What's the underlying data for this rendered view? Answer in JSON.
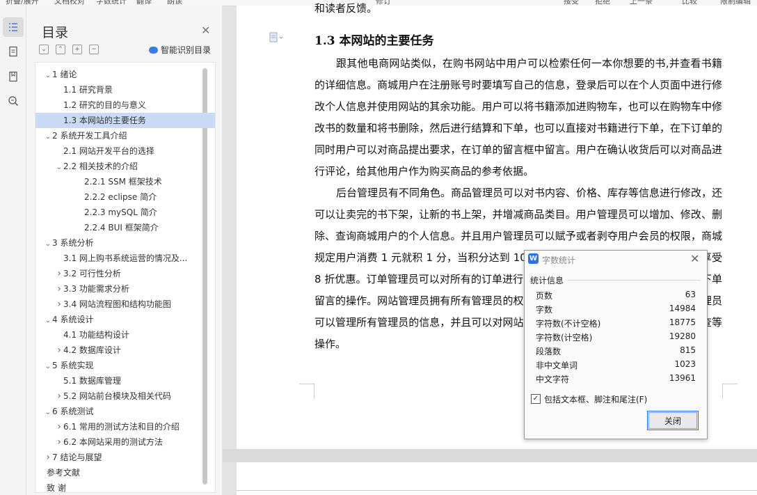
{
  "toolbar": {
    "items": [
      "折叠/展开",
      "文档校对",
      "字数统计",
      "翻译",
      "朗读",
      "修订",
      "接受",
      "拒绝",
      "上一条",
      "下一条",
      "比较",
      "限制编辑"
    ]
  },
  "rail": {
    "icons": [
      "outline-icon",
      "page-icon",
      "bookmark-icon",
      "find-icon"
    ]
  },
  "toc": {
    "title": "目录",
    "smart_label": "智能识别目录",
    "items": [
      {
        "text": "1  绪论",
        "level": 1,
        "arrow": "v"
      },
      {
        "text": "1.1 研究背景",
        "level": 2,
        "arrow": ""
      },
      {
        "text": "1.2 研究的目的与意义",
        "level": 2,
        "arrow": ""
      },
      {
        "text": "1.3 本网站的主要任务",
        "level": 2,
        "arrow": "",
        "selected": true
      },
      {
        "text": "2  系统开发工具介绍",
        "level": 1,
        "arrow": "v"
      },
      {
        "text": "2.1 网站开发平台的选择",
        "level": 2,
        "arrow": ""
      },
      {
        "text": "2.2 相关技术的介绍",
        "level": 2,
        "arrow": "v"
      },
      {
        "text": "2.2.1 SSM 框架技术",
        "level": 3,
        "arrow": ""
      },
      {
        "text": "2.2.2 eclipse 简介",
        "level": 3,
        "arrow": ""
      },
      {
        "text": "2.2.3 mySQL 简介",
        "level": 3,
        "arrow": ""
      },
      {
        "text": "2.2.4 BUI 框架简介",
        "level": 3,
        "arrow": ""
      },
      {
        "text": "3  系统分析",
        "level": 1,
        "arrow": "v"
      },
      {
        "text": "3.1  网上购书系统运营的情况及...",
        "level": 2,
        "arrow": ""
      },
      {
        "text": "3.2  可行性分析",
        "level": 2,
        "arrow": ">"
      },
      {
        "text": "3.3  功能需求分析",
        "level": 2,
        "arrow": ">"
      },
      {
        "text": "3.4 网站流程图和结构功能图",
        "level": 2,
        "arrow": ">"
      },
      {
        "text": "4  系统设计",
        "level": 1,
        "arrow": "v"
      },
      {
        "text": "4.1 功能结构设计",
        "level": 2,
        "arrow": ""
      },
      {
        "text": "4.2  数据库设计",
        "level": 2,
        "arrow": ">"
      },
      {
        "text": "5  系统实现",
        "level": 1,
        "arrow": "v"
      },
      {
        "text": "5.1  数据库管理",
        "level": 2,
        "arrow": ""
      },
      {
        "text": "5.2  网站前台模块及相关代码",
        "level": 2,
        "arrow": ">"
      },
      {
        "text": "6  系统测试",
        "level": 1,
        "arrow": "v"
      },
      {
        "text": "6.1 常用的测试方法和目的介绍",
        "level": 2,
        "arrow": ">"
      },
      {
        "text": "6.2 本网站采用的测试方法",
        "level": 2,
        "arrow": ">"
      },
      {
        "text": "7  结论与展望",
        "level": 1,
        "arrow": ">"
      },
      {
        "text": "参考文献",
        "level": 0,
        "arrow": ""
      },
      {
        "text": "致    谢",
        "level": 0,
        "arrow": ""
      }
    ]
  },
  "document": {
    "top_fragment": "和读者反馈。",
    "heading": "1.3 本网站的主要任务",
    "para1": "跟其他电商网站类似，在购书网站中用户可以检索任何一本你想要的书,并查看书籍的详细信息。商城用户在注册账号时要填写自己的信息，登录后可以在个人页面中进行修改个人信息并使用网站的其余功能。用户可以将书籍添加进购物车，也可以在购物车中修改书的数量和将书删除，然后进行结算和下单，也可以直接对书籍进行下单，在下订单的同时用户可以对商品提出要求，在订单的留言框中留言。用户在确认收货后可以对商品进行评论，给其他用户作为购买商品的参考依据。",
    "para2": "后台管理员有不同角色。商品管理员可以对书内容、价格、库存等信息进行修改，还可以让卖完的书下架，让新的书上架，并增减商品类目。用户管理员可以增加、修改、删除、查询商城用户的个人信息。并且用户管理员可以赋予或者剥夺用户会员的权限，商城规定用户消费 1 元就积 1 分，当积分达到 1000 分就可以成为会员，购书结算时将享受 8 折优惠。订单管理员可以对所有的订单进行管理，比如修改订单、查询订单、查看下单留言的操作。网站管理员拥有所有管理员的权限，还可以管理评论。最后商城用户管理员可以管理所有管理员的信息，并且可以对网站中除了用户信息以外的信息进行增删改查等操作。"
  },
  "dialog": {
    "title": "字数统计",
    "group_label": "统计信息",
    "stats": [
      {
        "label": "页数",
        "value": "63"
      },
      {
        "label": "字数",
        "value": "14984"
      },
      {
        "label": "字符数(不计空格)",
        "value": "18775"
      },
      {
        "label": "字符数(计空格)",
        "value": "19280"
      },
      {
        "label": "段落数",
        "value": "815"
      },
      {
        "label": "非中文单词",
        "value": "1023"
      },
      {
        "label": "中文字符",
        "value": "13961"
      }
    ],
    "checkbox_label": "包括文本框、脚注和尾注(F)",
    "checkbox_checked": true,
    "close_label": "关闭"
  }
}
